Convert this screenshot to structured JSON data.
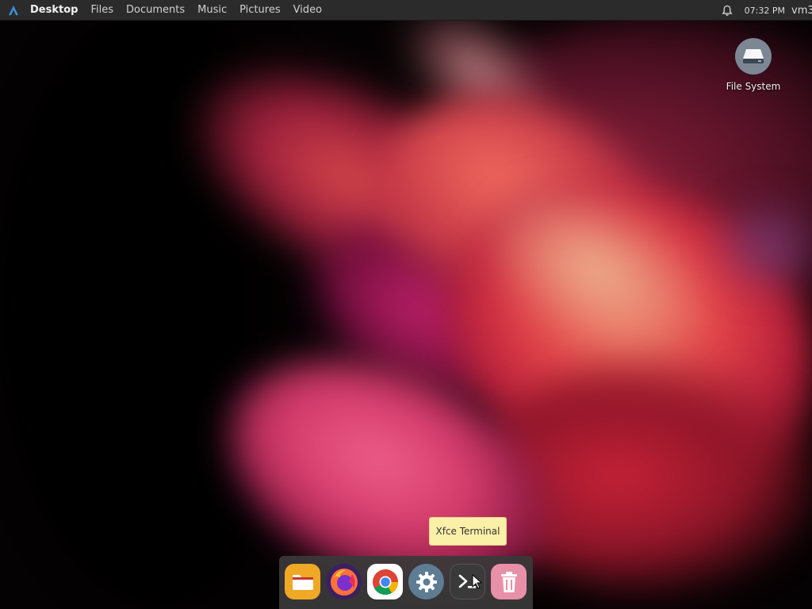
{
  "top_panel": {
    "places": [
      "Desktop",
      "Files",
      "Documents",
      "Music",
      "Pictures",
      "Video"
    ],
    "clock": "07:32 PM",
    "user": "vm3"
  },
  "desktop_icons": [
    {
      "label": "File System",
      "icon": "drive-harddisk-icon"
    }
  ],
  "tooltip": {
    "text": "Xfce Terminal"
  },
  "dock": {
    "items": [
      {
        "name": "files",
        "icon": "folder-icon",
        "color": "#f0a826"
      },
      {
        "name": "firefox",
        "icon": "firefox-icon",
        "color": "#3b1f63"
      },
      {
        "name": "chrome",
        "icon": "chrome-icon",
        "color": "#ffffff"
      },
      {
        "name": "settings",
        "icon": "gear-icon",
        "color": "#5e7c94"
      },
      {
        "name": "terminal",
        "icon": "terminal-icon",
        "color": "#3a3a3a"
      },
      {
        "name": "trash",
        "icon": "trash-icon",
        "color": "#e890a8"
      }
    ]
  },
  "colors": {
    "panel_bg": "#2b2b2b",
    "accent_blue": "#3f8fd8",
    "tooltip_bg": "#fbf0a8"
  }
}
